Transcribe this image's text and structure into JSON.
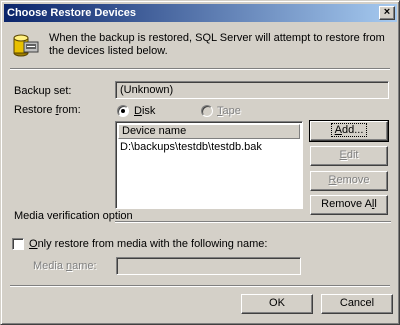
{
  "window": {
    "title": "Choose Restore Devices",
    "close_glyph": "×"
  },
  "intro": {
    "icon": "database-backup-icon",
    "text": "When the backup is restored, SQL Server will attempt to restore from the devices listed below."
  },
  "backup_set": {
    "label": "Backup set:",
    "value": "(Unknown)"
  },
  "restore_from": {
    "label_pre": "Restore ",
    "label_accel": "f",
    "label_post": "rom:",
    "options": [
      {
        "accel": "D",
        "rest": "isk",
        "selected": true,
        "enabled": true
      },
      {
        "accel": "T",
        "rest": "ape",
        "selected": false,
        "enabled": false
      }
    ]
  },
  "device_list": {
    "column_header": "Device name",
    "rows": [
      "D:\\backups\\testdb\\testdb.bak"
    ]
  },
  "buttons": {
    "add": {
      "accel": "A",
      "rest": "dd...",
      "enabled": true
    },
    "edit": {
      "accel": "E",
      "rest": "dit",
      "enabled": false
    },
    "remove": {
      "accel": "R",
      "rest": "emove",
      "enabled": false
    },
    "remove_all": {
      "pre": "Remove A",
      "accel": "l",
      "post": "l",
      "enabled": true
    },
    "ok": {
      "label": "OK"
    },
    "cancel": {
      "label": "Cancel"
    }
  },
  "media_verification": {
    "section_label": "Media verification option",
    "checkbox": {
      "accel": "O",
      "rest": "nly restore from media with the following name:",
      "checked": false
    },
    "media_name": {
      "pre": "Media ",
      "accel": "n",
      "post": "ame:",
      "value": ""
    }
  }
}
